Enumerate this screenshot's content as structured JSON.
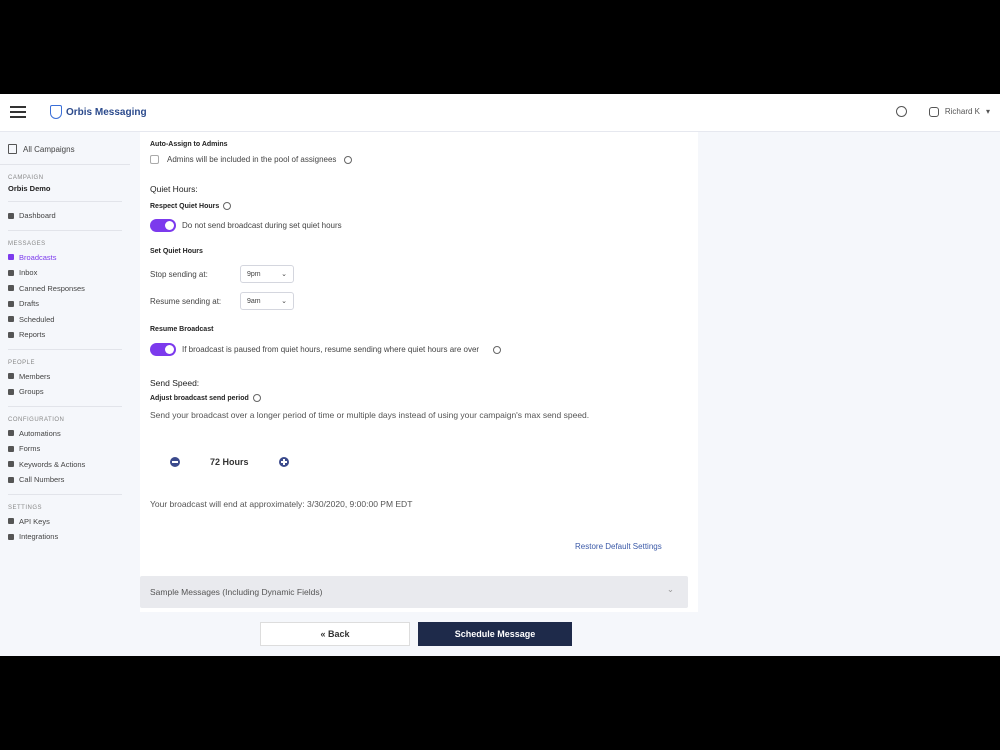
{
  "header": {
    "brand": "Orbis Messaging",
    "user": "Richard K",
    "user_caret": "▾"
  },
  "sidebar": {
    "back_link": "All Campaigns",
    "campaign_heading": "CAMPAIGN",
    "campaign_name": "Orbis Demo",
    "dashboard": "Dashboard",
    "messages_heading": "MESSAGES",
    "messages_items": [
      {
        "label": "Broadcasts",
        "active": true
      },
      {
        "label": "Inbox",
        "active": false
      },
      {
        "label": "Canned Responses",
        "active": false
      },
      {
        "label": "Drafts",
        "active": false
      },
      {
        "label": "Scheduled",
        "active": false
      },
      {
        "label": "Reports",
        "active": false
      }
    ],
    "people_heading": "PEOPLE",
    "people_items": [
      "Members",
      "Groups"
    ],
    "config_heading": "CONFIGURATION",
    "config_items": [
      "Automations",
      "Forms",
      "Keywords & Actions",
      "Call Numbers"
    ],
    "settings_heading": "SETTINGS",
    "settings_items": [
      "API Keys",
      "Integrations"
    ]
  },
  "form": {
    "auto_assign_label": "Auto-Assign to Admins",
    "auto_assign_text": "Admins will be included in the pool of assignees",
    "quiet_hours_title": "Quiet Hours:",
    "respect_label": "Respect Quiet Hours",
    "respect_text": "Do not send broadcast during set quiet hours",
    "set_label": "Set Quiet Hours",
    "stop_label": "Stop sending at:",
    "stop_value": "9pm",
    "resume_label": "Resume sending at:",
    "resume_value": "9am",
    "resume_broadcast_label": "Resume Broadcast",
    "resume_broadcast_text": "If broadcast is paused from quiet hours, resume sending where quiet hours are over",
    "send_speed_title": "Send Speed:",
    "adjust_label": "Adjust broadcast send period",
    "adjust_desc": "Send your broadcast over a longer period of time or multiple days instead of using your campaign's max send speed.",
    "period_value": "72 Hours",
    "end_text": "Your broadcast will end at approximately: 3/30/2020, 9:00:00 PM EDT",
    "restore_link": "Restore Default Settings"
  },
  "accordion": {
    "label": "Sample Messages (Including Dynamic Fields)",
    "caret": "⌄"
  },
  "footer": {
    "back": "« Back",
    "schedule": "Schedule Message"
  }
}
